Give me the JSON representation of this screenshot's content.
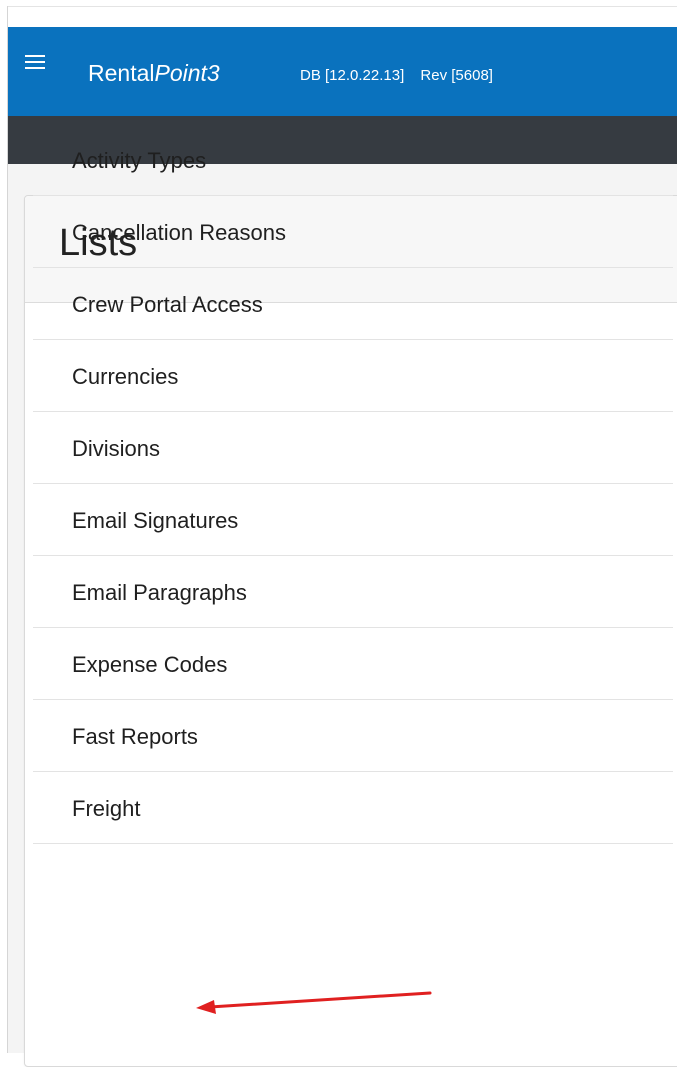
{
  "header": {
    "menu_icon": "hamburger-menu-icon",
    "brand_regular": "Rental",
    "brand_italic": "Point3",
    "db_version": "DB [12.0.22.13]",
    "revision": "Rev [5608]",
    "brand_color": "#0a72be",
    "subbar_color": "#363b41"
  },
  "card": {
    "title": "Lists"
  },
  "list": {
    "items": [
      {
        "label": "Activity Types"
      },
      {
        "label": "Cancellation Reasons"
      },
      {
        "label": "Crew Portal Access"
      },
      {
        "label": "Currencies"
      },
      {
        "label": "Divisions"
      },
      {
        "label": "Email Signatures"
      },
      {
        "label": "Email Paragraphs"
      },
      {
        "label": "Expense Codes"
      },
      {
        "label": "Fast Reports"
      },
      {
        "label": "Freight"
      }
    ]
  },
  "annotation": {
    "arrow_color": "#e02020",
    "arrow_target": "Freight"
  }
}
